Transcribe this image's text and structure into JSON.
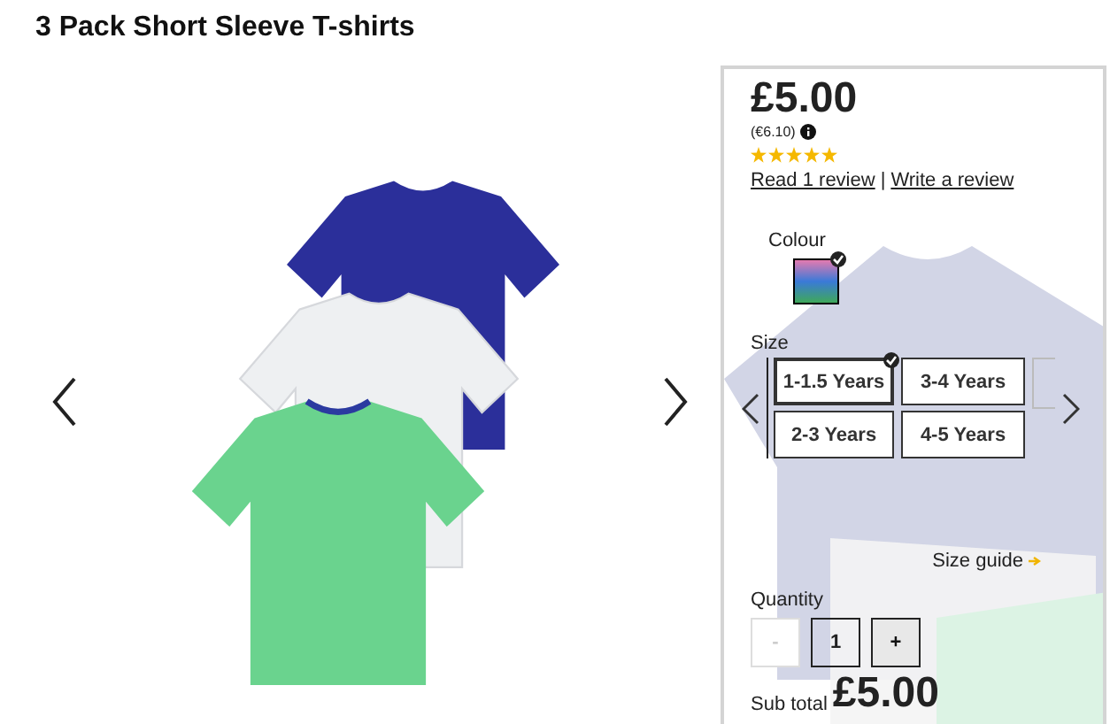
{
  "title": "3 Pack Short Sleeve T-shirts",
  "panel": {
    "price": "£5.00",
    "price_alt": "(€6.10)",
    "rating": {
      "stars": 5
    },
    "links": [
      {
        "label": "Read 1 review"
      },
      {
        "label": "Write a review"
      }
    ],
    "link_separator": "|",
    "colour_label": "Colour",
    "swatches": [
      {
        "selected": true
      }
    ],
    "size_label": "Size",
    "sizes": [
      {
        "label": "1-1.5 Years",
        "selected": true
      },
      {
        "label": "3-4 Years",
        "selected": false
      },
      {
        "label": "2-3 Years",
        "selected": false
      },
      {
        "label": "4-5 Years",
        "selected": false
      }
    ],
    "size_guide": "Size guide",
    "quantity_label": "Quantity",
    "quantity": {
      "minus": "-",
      "value": "1",
      "plus": "+",
      "minus_disabled": true
    },
    "subtotal_label": "Sub total",
    "subtotal": "£5.00"
  }
}
